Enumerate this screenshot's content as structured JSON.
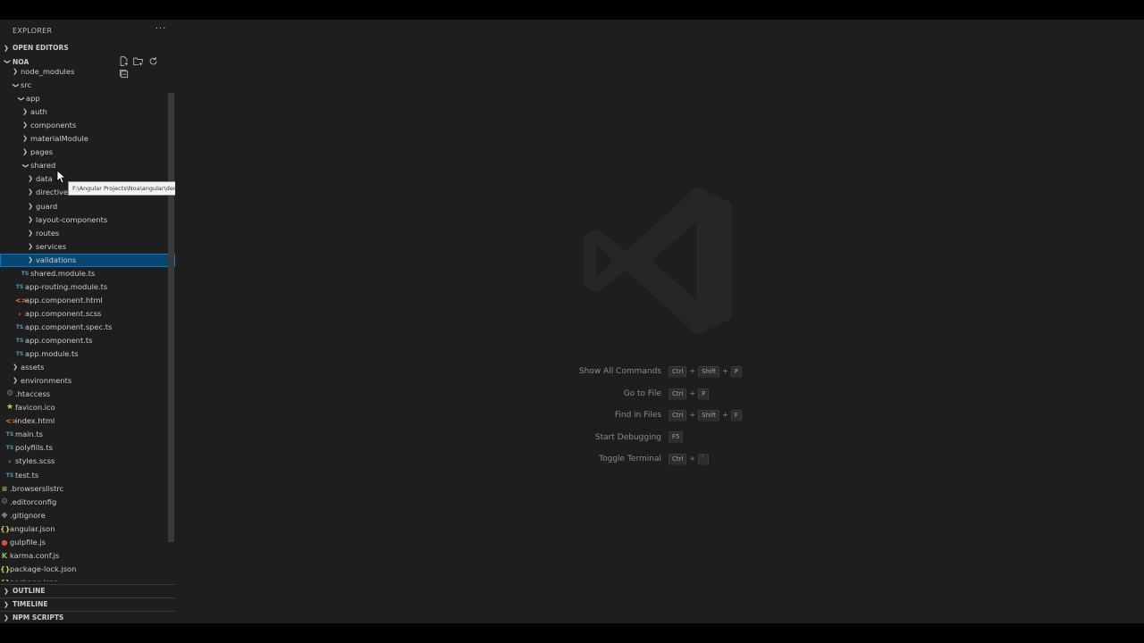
{
  "explorer": {
    "title": "EXPLORER",
    "more_label": "···"
  },
  "sections": {
    "open_editors": "OPEN EDITORS",
    "project": "NOA",
    "outline": "OUTLINE",
    "timeline": "TIMELINE",
    "npm_scripts": "NPM SCRIPTS"
  },
  "tree": [
    {
      "name": "node_modules",
      "type": "folder",
      "expanded": false
    },
    {
      "name": "src",
      "type": "folder",
      "expanded": true
    },
    {
      "name": "app",
      "type": "folder",
      "expanded": true
    },
    {
      "name": "auth",
      "type": "folder",
      "expanded": false
    },
    {
      "name": "components",
      "type": "folder",
      "expanded": false
    },
    {
      "name": "materialModule",
      "type": "folder",
      "expanded": false
    },
    {
      "name": "pages",
      "type": "folder",
      "expanded": false
    },
    {
      "name": "shared",
      "type": "folder",
      "expanded": true
    },
    {
      "name": "data",
      "type": "folder",
      "expanded": false
    },
    {
      "name": "directives",
      "type": "folder",
      "expanded": false
    },
    {
      "name": "guard",
      "type": "folder",
      "expanded": false
    },
    {
      "name": "layout-components",
      "type": "folder",
      "expanded": false
    },
    {
      "name": "routes",
      "type": "folder",
      "expanded": false
    },
    {
      "name": "services",
      "type": "folder",
      "expanded": false
    },
    {
      "name": "validations",
      "type": "folder",
      "expanded": false,
      "selected": true
    },
    {
      "name": "shared.module.ts",
      "type": "ts",
      "icon": "TS"
    },
    {
      "name": "app-routing.module.ts",
      "type": "ts",
      "icon": "TS"
    },
    {
      "name": "app.component.html",
      "type": "html",
      "icon": "<>"
    },
    {
      "name": "app.component.scss",
      "type": "scss",
      "icon": "𝓈"
    },
    {
      "name": "app.component.spec.ts",
      "type": "ts",
      "icon": "TS"
    },
    {
      "name": "app.component.ts",
      "type": "ts",
      "icon": "TS"
    },
    {
      "name": "app.module.ts",
      "type": "ts",
      "icon": "TS"
    },
    {
      "name": "assets",
      "type": "folder",
      "expanded": false
    },
    {
      "name": "environments",
      "type": "folder",
      "expanded": false
    },
    {
      "name": ".htaccess",
      "type": "gear",
      "icon": "⚙"
    },
    {
      "name": "favicon.ico",
      "type": "star",
      "icon": "★"
    },
    {
      "name": "index.html",
      "type": "html",
      "icon": "<>"
    },
    {
      "name": "main.ts",
      "type": "ts",
      "icon": "TS"
    },
    {
      "name": "polyfills.ts",
      "type": "ts",
      "icon": "TS"
    },
    {
      "name": "styles.scss",
      "type": "scss",
      "icon": "𝓈"
    },
    {
      "name": "test.ts",
      "type": "ts",
      "icon": "TS"
    },
    {
      "name": ".browserslistrc",
      "type": "rc",
      "icon": "≡"
    },
    {
      "name": ".editorconfig",
      "type": "gear",
      "icon": "⚙"
    },
    {
      "name": ".gitignore",
      "type": "gear",
      "icon": "◆"
    },
    {
      "name": "angular.json",
      "type": "json",
      "icon": "{}"
    },
    {
      "name": "gulpfile.js",
      "type": "gulp",
      "icon": "●"
    },
    {
      "name": "karma.conf.js",
      "type": "karma",
      "icon": "K"
    },
    {
      "name": "package-lock.json",
      "type": "json",
      "icon": "{}"
    },
    {
      "name": "package.json",
      "type": "json",
      "icon": "{}"
    }
  ],
  "tooltip": "F:\\Angular Projects\\Noa\\angular\\demo\\version\\noa\\src\\app\\shared",
  "shortcuts": [
    {
      "label": "Show All Commands",
      "keys": [
        "Ctrl",
        "Shift",
        "P"
      ]
    },
    {
      "label": "Go to File",
      "keys": [
        "Ctrl",
        "P"
      ]
    },
    {
      "label": "Find in Files",
      "keys": [
        "Ctrl",
        "Shift",
        "F"
      ]
    },
    {
      "label": "Start Debugging",
      "keys": [
        "F5"
      ]
    },
    {
      "label": "Toggle Terminal",
      "keys": [
        "Ctrl",
        "`"
      ]
    }
  ],
  "colors": {
    "selection": "#094771",
    "focus_border": "#0078d4",
    "ts_icon": "#519aba",
    "html_icon": "#e37933",
    "scss_icon": "#f55385",
    "json_icon": "#cbcb41"
  }
}
